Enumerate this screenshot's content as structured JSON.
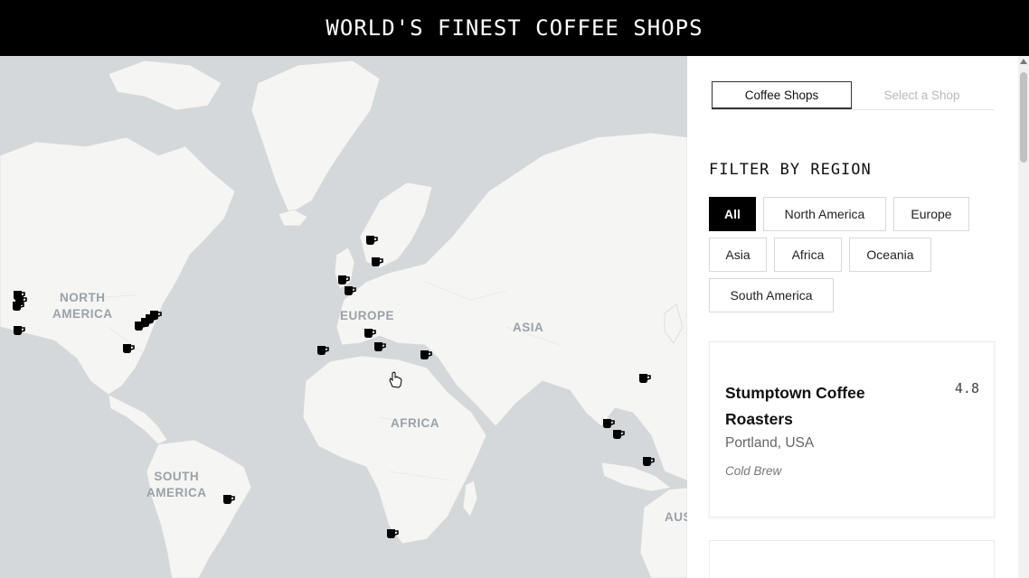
{
  "header": {
    "title": "WORLD'S FINEST COFFEE SHOPS"
  },
  "map": {
    "region_labels": {
      "north_america": "NORTH\nAMERICA",
      "south_america": "SOUTH\nAMERICA",
      "europe": "EUROPE",
      "africa": "AFRICA",
      "asia": "ASIA",
      "australia": "AUS"
    },
    "marker_icon": "coffee-cup-icon",
    "marker_count": 24,
    "colors": {
      "water": "#d4d8da",
      "land": "#f5f5f4",
      "borders": "#d9d9d9",
      "marker": "#000000"
    }
  },
  "panel": {
    "tabs": [
      {
        "label": "Coffee Shops",
        "active": true
      },
      {
        "label": "Select a Shop",
        "active": false
      }
    ],
    "filter_title": "FILTER BY REGION",
    "filters": [
      {
        "label": "All",
        "active": true
      },
      {
        "label": "North America",
        "active": false
      },
      {
        "label": "Europe",
        "active": false
      },
      {
        "label": "Asia",
        "active": false
      },
      {
        "label": "Africa",
        "active": false
      },
      {
        "label": "Oceania",
        "active": false
      },
      {
        "label": "South America",
        "active": false
      }
    ],
    "shops": [
      {
        "name": "Stumptown Coffee Roasters",
        "rating": "4.8",
        "location": "Portland, USA",
        "specialty": "Cold Brew"
      }
    ]
  }
}
